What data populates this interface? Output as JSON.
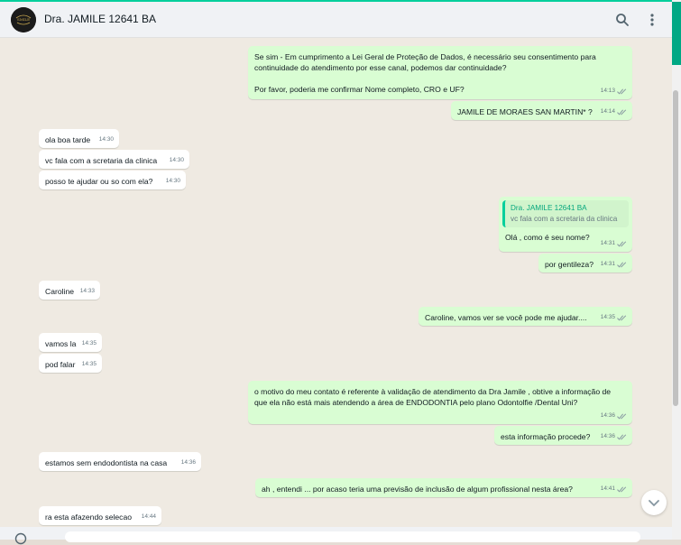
{
  "header": {
    "contact_name": "Dra. JAMILE 12641 BA",
    "avatar_text": "SMILE",
    "search_icon": "search-icon",
    "menu_icon": "kebab-menu-icon"
  },
  "messages": [
    {
      "dir": "out",
      "text": "Se sim - Em cumprimento a Lei Geral de Proteção de Dados, é necessário seu consentimento para continuidade do atendimento por esse canal, podemos dar continuidade?\n\nPor favor, poderia me confirmar Nome completo, CRO e UF?",
      "time": "14:13"
    },
    {
      "dir": "out",
      "text": "JAMILE DE MORAES SAN MARTIN*  ?",
      "time": "14:14"
    },
    {
      "dir": "in",
      "text": "ola boa tarde",
      "time": "14:30"
    },
    {
      "dir": "in",
      "text": "vc fala com a scretaria da clinica",
      "time": "14:30"
    },
    {
      "dir": "in",
      "text": "posso te ajudar ou so com ela?",
      "time": "14:30"
    },
    {
      "dir": "out",
      "quote_name": "Dra. JAMILE 12641 BA",
      "quote_text": "vc fala com a scretaria da clinica",
      "text": "Olá , como é seu nome?",
      "time": "14:31"
    },
    {
      "dir": "out",
      "text": "por gentileza?",
      "time": "14:31"
    },
    {
      "dir": "in",
      "text": "Caroline",
      "time": "14:33"
    },
    {
      "dir": "out",
      "text": "Caroline, vamos ver se você pode me ajudar....",
      "time": "14:35"
    },
    {
      "dir": "in",
      "text": "vamos la",
      "time": "14:35"
    },
    {
      "dir": "in",
      "text": "pod falar",
      "time": "14:35"
    },
    {
      "dir": "out",
      "text": "o motivo do meu contato é referente à validação de atendimento da Dra Jamile , obtive a informação de que ela não está mais atendendo a área de ENDODONTIA pelo plano Odontolfie /Dental Uni?",
      "time": "14:36"
    },
    {
      "dir": "out",
      "text": "esta informação procede?",
      "time": "14:36"
    },
    {
      "dir": "in",
      "text": "estamos sem endodontista na casa",
      "time": "14:36"
    },
    {
      "dir": "out",
      "text": "ah , entendi ... por acaso teria uma previsão de inclusão de algum profissional nesta área?",
      "time": "14:41"
    },
    {
      "dir": "in",
      "text": "ra esta afazendo selecao",
      "time": "14:44"
    }
  ],
  "colors": {
    "outgoing": "#d9fdd3",
    "incoming": "#ffffff",
    "read_tick": "#53bdeb",
    "accent": "#06cf9c"
  }
}
